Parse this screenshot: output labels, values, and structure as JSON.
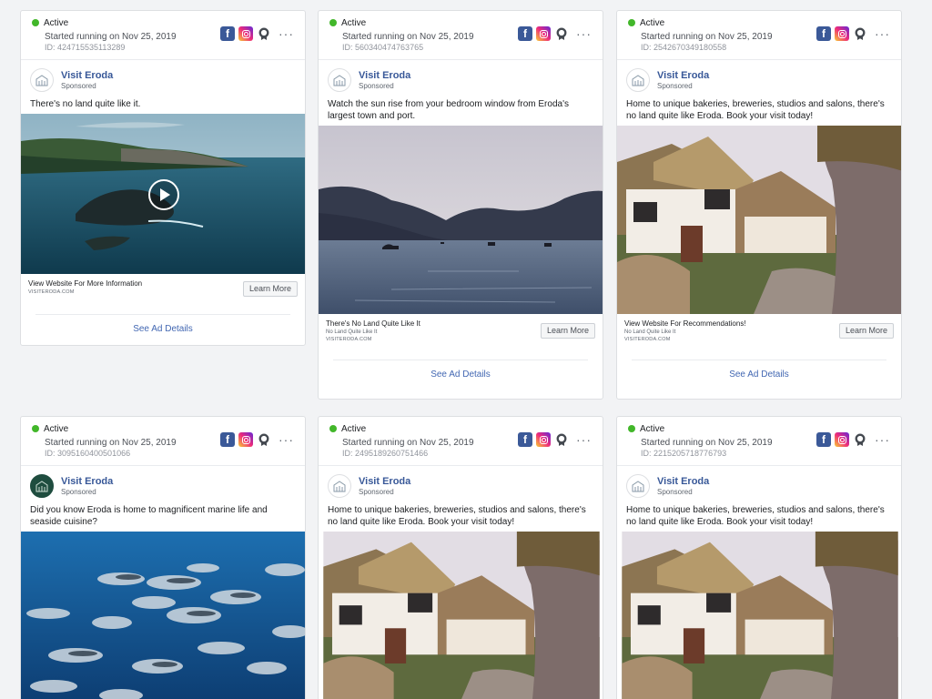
{
  "cards": [
    {
      "status": "Active",
      "started": "Started running on Nov 25, 2019",
      "id": "ID: 424715535113289",
      "page_name": "Visit Eroda",
      "sponsored": "Sponsored",
      "text": "There's no land quite like it.",
      "cta_title": "View Website For More Information",
      "cta_subtitle": "",
      "cta_domain": "VISITERODA.COM",
      "cta_button": "Learn More",
      "details_link": "See Ad Details",
      "media": "coast-video"
    },
    {
      "status": "Active",
      "started": "Started running on Nov 25, 2019",
      "id": "ID: 560340474763765",
      "page_name": "Visit Eroda",
      "sponsored": "Sponsored",
      "text": "Watch the sun rise from your bedroom window from Eroda's largest town and port.",
      "cta_title": "There's No Land Quite Like It",
      "cta_subtitle": "No Land Quite Like It",
      "cta_domain": "VISITERODA.COM",
      "cta_button": "Learn More",
      "details_link": "See Ad Details",
      "media": "lake"
    },
    {
      "status": "Active",
      "started": "Started running on Nov 25, 2019",
      "id": "ID: 2542670349180558",
      "page_name": "Visit Eroda",
      "sponsored": "Sponsored",
      "text": "Home to unique bakeries, breweries, studios and salons, there's no land quite like Eroda. Book your visit today!",
      "cta_title": "View Website For Recommendations!",
      "cta_subtitle": "No Land Quite Like It",
      "cta_domain": "VISITERODA.COM",
      "cta_button": "Learn More",
      "details_link": "See Ad Details",
      "media": "cottage"
    },
    {
      "status": "Active",
      "started": "Started running on Nov 25, 2019",
      "id": "ID: 3095160400501066",
      "page_name": "Visit Eroda",
      "sponsored": "Sponsored",
      "text": "Did you know Eroda is home to magnificent marine life and seaside cuisine?",
      "media": "fish"
    },
    {
      "status": "Active",
      "started": "Started running on Nov 25, 2019",
      "id": "ID: 2495189260751466",
      "page_name": "Visit Eroda",
      "sponsored": "Sponsored",
      "text": "Home to unique bakeries, breweries, studios and salons, there's no land quite like Eroda. Book your visit today!",
      "media": "cottage"
    },
    {
      "status": "Active",
      "started": "Started running on Nov 25, 2019",
      "id": "ID: 2215205718776793",
      "page_name": "Visit Eroda",
      "sponsored": "Sponsored",
      "text": "Home to unique bakeries, breweries, studios and salons, there's no land quite like Eroda. Book your visit today!",
      "media": "cottage"
    }
  ],
  "icons": {
    "platforms": [
      "facebook-icon",
      "instagram-icon",
      "audience-network-icon"
    ],
    "more": "more-options-icon"
  },
  "colors": {
    "active": "#42b72a",
    "link": "#4267b2",
    "facebook": "#3b5998"
  }
}
